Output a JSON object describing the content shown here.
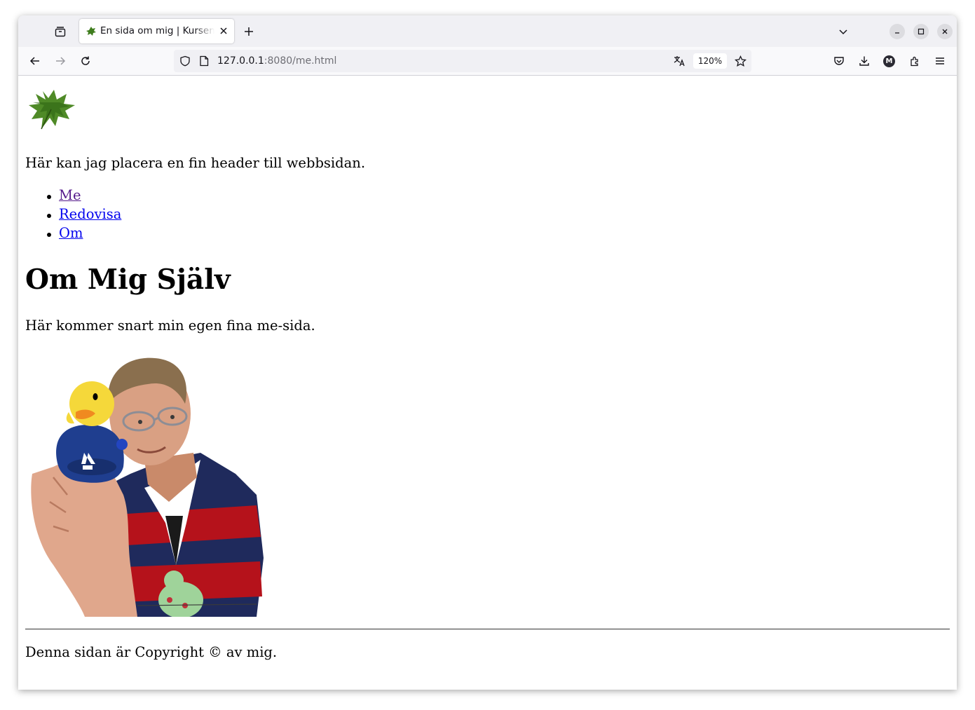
{
  "browser": {
    "tab": {
      "title": "En sida om mig | Kursen webtec",
      "close_label": "×"
    },
    "url": {
      "host": "127.0.0.1",
      "path": ":8080/me.html"
    },
    "zoom": "120%",
    "account_initial": "M"
  },
  "page": {
    "header_text": "Här kan jag placera en fin header till webbsidan.",
    "nav": [
      {
        "label": "Me",
        "visited": true
      },
      {
        "label": "Redovisa",
        "visited": false
      },
      {
        "label": "Om",
        "visited": false
      }
    ],
    "title": "Om Mig Själv",
    "intro": "Här kommer snart min egen fina me-sida.",
    "footer": "Denna sidan är Copyright © av mig."
  },
  "colors": {
    "link": "#0000ee",
    "visited_link": "#551a8b",
    "leaf_green": "#3f7d1e"
  }
}
